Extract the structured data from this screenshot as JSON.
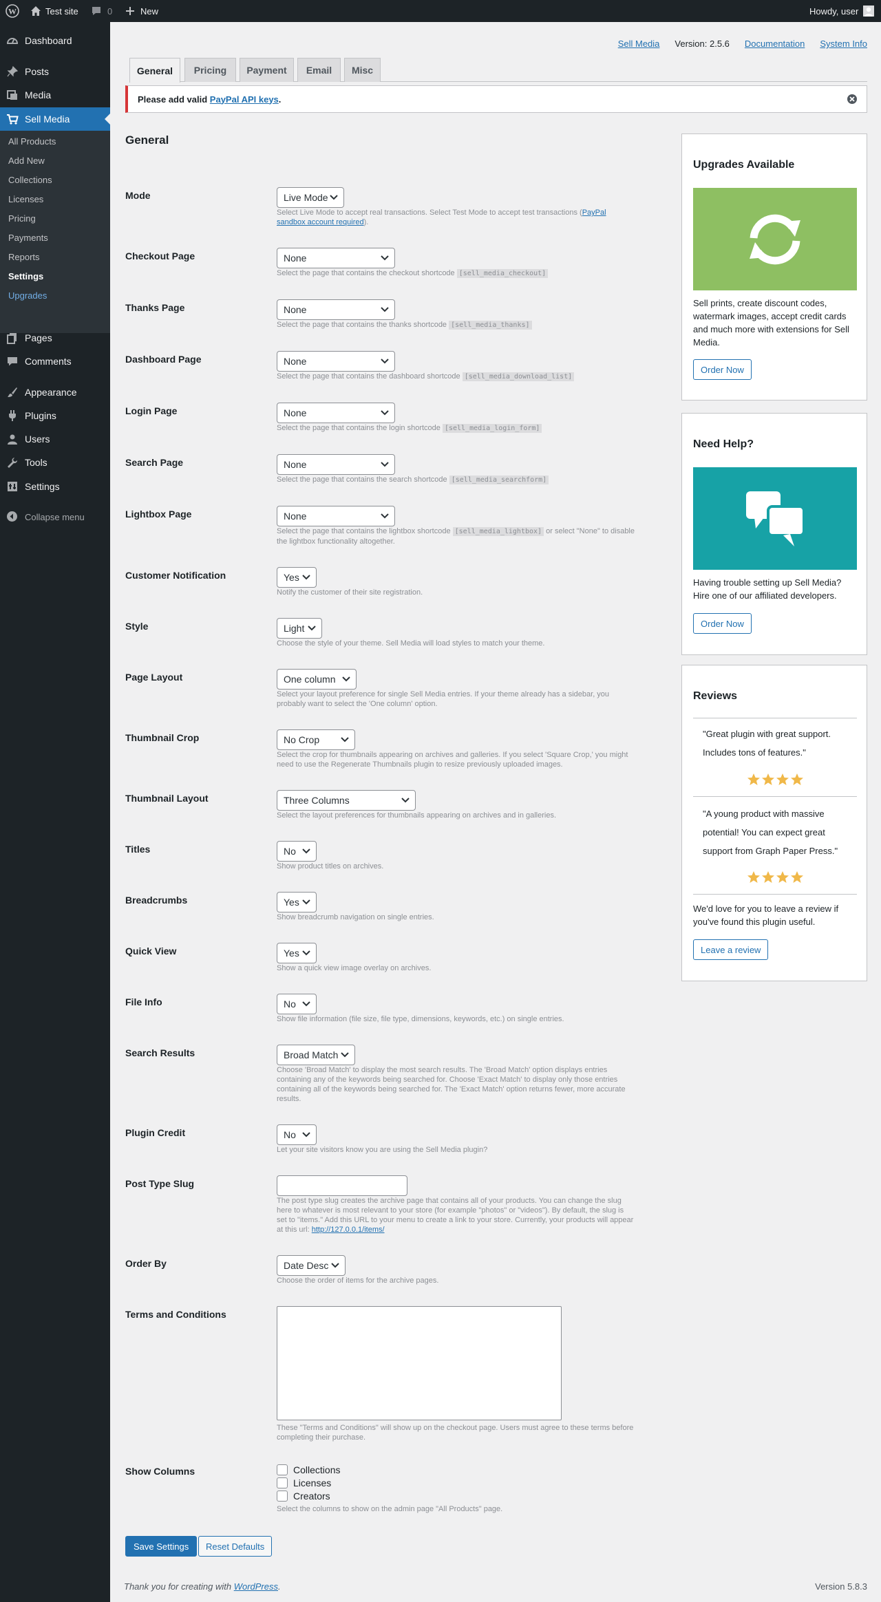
{
  "colors": {
    "admin_dark": "#1d2327",
    "accent_blue": "#2271b1",
    "error_red": "#d63638",
    "green_card": "#8ebf62",
    "teal_card": "#17a2a6",
    "star_gold": "#f0b849"
  },
  "adminbar": {
    "site_name": "Test site",
    "comments_count": "0",
    "new_label": "New",
    "howdy": "Howdy, user"
  },
  "sidebar": {
    "items": [
      {
        "label": "Dashboard",
        "icon": "dashboard-icon"
      },
      {
        "label": "Posts",
        "icon": "pin-icon"
      },
      {
        "label": "Media",
        "icon": "media-icon"
      },
      {
        "label": "Sell Media",
        "icon": "cart-icon"
      },
      {
        "label": "Pages",
        "icon": "pages-icon"
      },
      {
        "label": "Comments",
        "icon": "comments-icon"
      },
      {
        "label": "Appearance",
        "icon": "brush-icon"
      },
      {
        "label": "Plugins",
        "icon": "plug-icon"
      },
      {
        "label": "Users",
        "icon": "user-icon"
      },
      {
        "label": "Tools",
        "icon": "wrench-icon"
      },
      {
        "label": "Settings",
        "icon": "settings-icon"
      }
    ],
    "submenu": [
      "All Products",
      "Add New",
      "Collections",
      "Licenses",
      "Pricing",
      "Payments",
      "Reports",
      "Settings",
      "Upgrades"
    ],
    "collapse_label": "Collapse menu"
  },
  "toplinks": {
    "sell_media": "Sell Media",
    "version": "Version: 2.5.6",
    "documentation": "Documentation",
    "system_info": "System Info"
  },
  "tabs": [
    "General",
    "Pricing",
    "Payment",
    "Email",
    "Misc"
  ],
  "notice": {
    "prefix": "Please add valid ",
    "link": "PayPal API keys",
    "suffix": "."
  },
  "section_title": "General",
  "fields": {
    "mode": {
      "label": "Mode",
      "value": "Live Mode",
      "desc_pre": "Select Live Mode to accept real transactions. Select Test Mode to accept test transactions (",
      "desc_link": "PayPal sandbox account required",
      "desc_post": ")."
    },
    "checkout_page": {
      "label": "Checkout Page",
      "value": "None",
      "desc": "Select the page that contains the checkout shortcode",
      "code": "[sell_media_checkout]"
    },
    "thanks_page": {
      "label": "Thanks Page",
      "value": "None",
      "desc": "Select the page that contains the thanks shortcode",
      "code": "[sell_media_thanks]"
    },
    "dashboard_page": {
      "label": "Dashboard Page",
      "value": "None",
      "desc": "Select the page that contains the dashboard shortcode",
      "code": "[sell_media_download_list]"
    },
    "login_page": {
      "label": "Login Page",
      "value": "None",
      "desc": "Select the page that contains the login shortcode",
      "code": "[sell_media_login_form]"
    },
    "search_page": {
      "label": "Search Page",
      "value": "None",
      "desc": "Select the page that contains the search shortcode",
      "code": "[sell_media_searchform]"
    },
    "lightbox_page": {
      "label": "Lightbox Page",
      "value": "None",
      "desc": "Select the page that contains the lightbox shortcode",
      "code": "[sell_media_lightbox]",
      "desc_post": " or select \"None\" to disable the lightbox functionality altogether."
    },
    "customer_notification": {
      "label": "Customer Notification",
      "value": "Yes",
      "desc": "Notify the customer of their site registration."
    },
    "style": {
      "label": "Style",
      "value": "Light",
      "desc": "Choose the style of your theme. Sell Media will load styles to match your theme."
    },
    "page_layout": {
      "label": "Page Layout",
      "value": "One column",
      "desc": "Select your layout preference for single Sell Media entries. If your theme already has a sidebar, you probably want to select the 'One column' option."
    },
    "thumbnail_crop": {
      "label": "Thumbnail Crop",
      "value": "No Crop",
      "desc": "Select the crop for thumbnails appearing on archives and galleries. If you select 'Square Crop,' you might need to use the Regenerate Thumbnails plugin to resize previously uploaded images."
    },
    "thumbnail_layout": {
      "label": "Thumbnail Layout",
      "value": "Three Columns",
      "desc": "Select the layout preferences for thumbnails appearing on archives and in galleries."
    },
    "titles": {
      "label": "Titles",
      "value": "No",
      "desc": "Show product titles on archives."
    },
    "breadcrumbs": {
      "label": "Breadcrumbs",
      "value": "Yes",
      "desc": "Show breadcrumb navigation on single entries."
    },
    "quick_view": {
      "label": "Quick View",
      "value": "Yes",
      "desc": "Show a quick view image overlay on archives."
    },
    "file_info": {
      "label": "File Info",
      "value": "No",
      "desc": "Show file information (file size, file type, dimensions, keywords, etc.) on single entries."
    },
    "search_results": {
      "label": "Search Results",
      "value": "Broad Match",
      "desc": "Choose 'Broad Match' to display the most search results. The 'Broad Match' option displays entries containing any of the keywords being searched for. Choose 'Exact Match' to display only those entries containing all of the keywords being searched for. The 'Exact Match' option returns fewer, more accurate results."
    },
    "plugin_credit": {
      "label": "Plugin Credit",
      "value": "No",
      "desc": "Let your site visitors know you are using the Sell Media plugin?"
    },
    "post_type_slug": {
      "label": "Post Type Slug",
      "value": "",
      "desc": "The post type slug creates the archive page that contains all of your products. You can change the slug here to whatever is most relevant to your store (for example \"photos\" or \"videos\"). By default, the slug is set to \"items.\" Add this URL to your menu to create a link to your store. Currently, your products will appear at this url: ",
      "link": "http://127.0.0.1/items/"
    },
    "order_by": {
      "label": "Order By",
      "value": "Date Desc",
      "desc": "Choose the order of items for the archive pages."
    },
    "terms": {
      "label": "Terms and Conditions",
      "value": "",
      "desc": "These \"Terms and Conditions\" will show up on the checkout page. Users must agree to these terms before completing their purchase."
    },
    "show_columns": {
      "label": "Show Columns",
      "options": [
        "Collections",
        "Licenses",
        "Creators"
      ],
      "desc": "Select the columns to show on the admin page \"All Products\" page."
    }
  },
  "buttons": {
    "save": "Save Settings",
    "reset": "Reset Defaults"
  },
  "footer": {
    "thanks_pre": "Thank you for creating with ",
    "thanks_link": "WordPress",
    "thanks_post": ".",
    "version": "Version 5.8.3"
  },
  "widgets": {
    "upgrades": {
      "title": "Upgrades Available",
      "text": "Sell prints, create discount codes, watermark images, accept credit cards and much more with extensions for Sell Media.",
      "button": "Order Now"
    },
    "help": {
      "title": "Need Help?",
      "text": "Having trouble setting up Sell Media? Hire one of our affiliated developers.",
      "button": "Order Now"
    },
    "reviews": {
      "title": "Reviews",
      "quote1": "\"Great plugin with great support. Includes tons of features.\"",
      "quote2": "\"A young product with massive potential! You can expect great support from Graph Paper Press.\"",
      "rating1": 4,
      "rating2": 4,
      "text": "We'd love for you to leave a review if you've found this plugin useful.",
      "button": "Leave a review"
    }
  }
}
